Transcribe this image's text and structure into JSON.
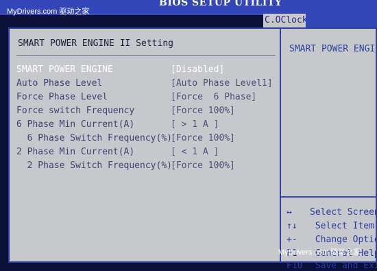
{
  "window": {
    "title": "BIOS SETUP UTILITY",
    "active_tab": "C.OClock"
  },
  "watermark": {
    "top": "MyDrivers.com 驱动之家",
    "bottom": "MyDrivers.com 驱动之家"
  },
  "section": {
    "title": "SMART POWER ENGINE II Setting"
  },
  "settings": [
    {
      "label": "SMART POWER ENGINE",
      "value": "[Disabled]"
    },
    {
      "label": "Auto Phase Level",
      "value": "[Auto Phase Level1]"
    },
    {
      "label": "Force Phase Level",
      "value": "[Force  6 Phase]"
    },
    {
      "label": "Force switch Frequency",
      "value": "[Force 100%]"
    },
    {
      "label": "6 Phase Min Current(A)",
      "value": "[ > 1 A ]"
    },
    {
      "label": "  6 Phase Switch Frequency(%)",
      "value": "[Force 100%]"
    },
    {
      "label": "2 Phase Min Current(A)",
      "value": "[ < 1 A ]"
    },
    {
      "label": "  2 Phase Switch Frequency(%)",
      "value": "[Force 100%]"
    }
  ],
  "help": {
    "title": "SMART POWER ENGIN",
    "keys": [
      {
        "key": "↔",
        "desc": "Select Screen"
      },
      {
        "key": "↑↓",
        "desc": " Select Item"
      },
      {
        "key": "+-",
        "desc": " Change Option"
      },
      {
        "key": "F1",
        "desc": " General Help"
      },
      {
        "key": "F10",
        "desc": " Save and Exit"
      }
    ]
  }
}
